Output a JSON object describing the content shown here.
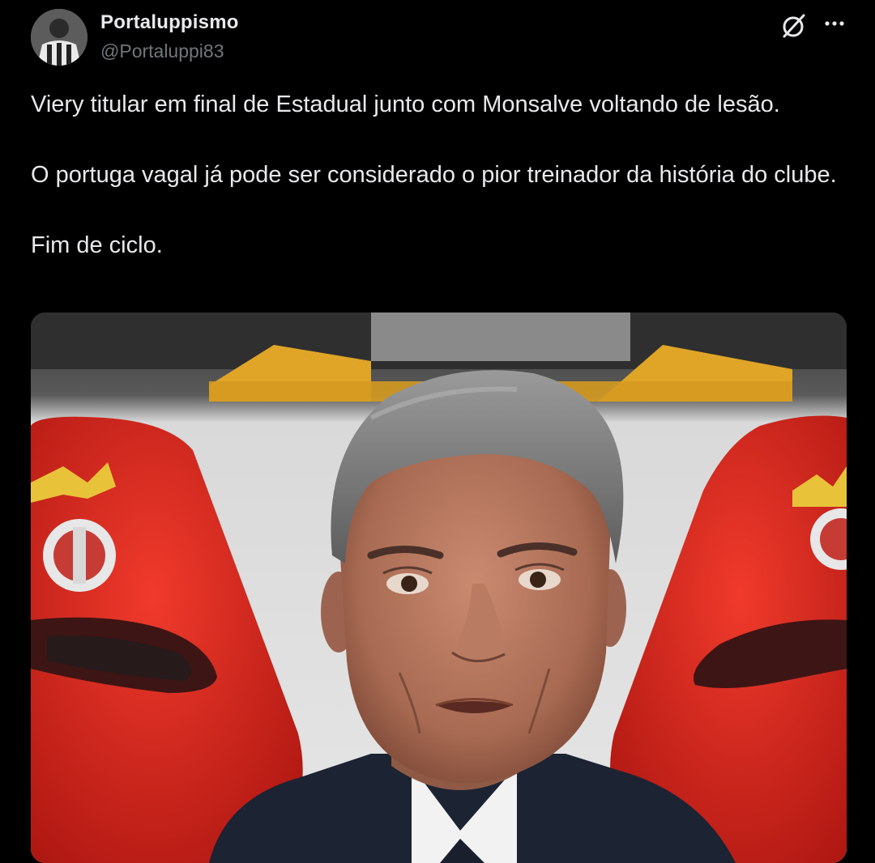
{
  "author": {
    "display_name": "Portaluppismo",
    "handle": "@Portaluppi83",
    "avatar_icon": "profile-avatar"
  },
  "header_actions": {
    "grok_icon": "grok-icon",
    "more_icon": "more-horizontal-icon"
  },
  "tweet": {
    "line1": "Viery titular em final de Estadual junto com Monsalve voltando de lesão.",
    "line2": "O portuga vagal já pode ser considerado o pior treinador da história do clube.",
    "line3": "Fim de ciclo."
  },
  "colors": {
    "background": "#000000",
    "text": "#e7e9ea",
    "secondary_text": "#71767b",
    "seat_red": "#d8251d"
  }
}
